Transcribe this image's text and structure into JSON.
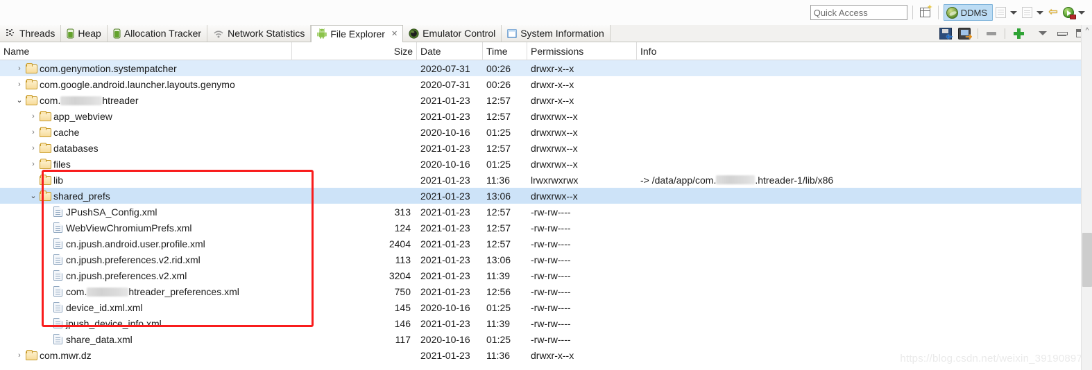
{
  "toolbar": {
    "quick_access_placeholder": "Quick Access",
    "quick_access_value": "",
    "new_perspective_icon": "new-perspective-icon",
    "perspective_ddms_label": "DDMS",
    "step_into_icon": "step-into-icon",
    "step_out_icon": "step-out-icon",
    "back_icon": "back-arrow-icon",
    "run_icon": "run-icon",
    "accent_selected": "#bcdcf4"
  },
  "tabs": [
    {
      "label": "Threads",
      "icon": "threads-icon",
      "active": false,
      "closable": false
    },
    {
      "label": "Heap",
      "icon": "heap-icon",
      "active": false,
      "closable": false
    },
    {
      "label": "Allocation Tracker",
      "icon": "allocation-tracker-icon",
      "active": false,
      "closable": false
    },
    {
      "label": "Network Statistics",
      "icon": "network-statistics-icon",
      "active": false,
      "closable": false
    },
    {
      "label": "File Explorer",
      "icon": "android-icon",
      "active": true,
      "closable": true
    },
    {
      "label": "Emulator Control",
      "icon": "emulator-control-icon",
      "active": false,
      "closable": false
    },
    {
      "label": "System Information",
      "icon": "system-information-icon",
      "active": false,
      "closable": false
    }
  ],
  "tab_close_glyph": "✕",
  "view_tools": [
    {
      "name": "pull-file-from-device-button",
      "icon": "pull-file-icon"
    },
    {
      "name": "push-file-onto-device-button",
      "icon": "push-file-icon"
    },
    {
      "name": "delete-button",
      "icon": "minus-icon"
    },
    {
      "name": "new-folder-button",
      "icon": "plus-icon"
    },
    {
      "name": "view-menu-button",
      "icon": "chevron-down-icon"
    },
    {
      "name": "minimize-button",
      "icon": "minimize-icon"
    },
    {
      "name": "maximize-button",
      "icon": "maximize-icon"
    }
  ],
  "columns": [
    {
      "key": "name",
      "label": "Name",
      "align": "left"
    },
    {
      "key": "size",
      "label": "Size",
      "align": "right"
    },
    {
      "key": "date",
      "label": "Date",
      "align": "left"
    },
    {
      "key": "time",
      "label": "Time",
      "align": "left"
    },
    {
      "key": "permissions",
      "label": "Permissions",
      "align": "left"
    },
    {
      "key": "info",
      "label": "Info",
      "align": "left"
    }
  ],
  "rows": [
    {
      "name": "com.genymotion.systempatcher",
      "size": "",
      "date": "2020-07-31",
      "time": "00:26",
      "permissions": "drwxr-x--x",
      "info": "",
      "depth": 1,
      "kind": "folder",
      "twisty": "collapsed",
      "selected": "light"
    },
    {
      "name": "com.google.android.launcher.layouts.genymo",
      "size": "",
      "date": "2020-07-31",
      "time": "00:26",
      "permissions": "drwxr-x--x",
      "info": "",
      "depth": 1,
      "kind": "folder",
      "twisty": "collapsed",
      "selected": "none"
    },
    {
      "name_prefix": "com.",
      "name_redacted": true,
      "name_suffix": "htreader",
      "name": "com.▮▮▮▮htreader",
      "size": "",
      "date": "2021-01-23",
      "time": "12:57",
      "permissions": "drwxr-x--x",
      "info": "",
      "depth": 1,
      "kind": "folder",
      "twisty": "expanded",
      "selected": "none"
    },
    {
      "name": "app_webview",
      "size": "",
      "date": "2021-01-23",
      "time": "12:57",
      "permissions": "drwxrwx--x",
      "info": "",
      "depth": 2,
      "kind": "folder",
      "twisty": "collapsed",
      "selected": "none"
    },
    {
      "name": "cache",
      "size": "",
      "date": "2020-10-16",
      "time": "01:25",
      "permissions": "drwxrwx--x",
      "info": "",
      "depth": 2,
      "kind": "folder",
      "twisty": "collapsed",
      "selected": "none"
    },
    {
      "name": "databases",
      "size": "",
      "date": "2021-01-23",
      "time": "12:57",
      "permissions": "drwxrwx--x",
      "info": "",
      "depth": 2,
      "kind": "folder",
      "twisty": "collapsed",
      "selected": "none"
    },
    {
      "name": "files",
      "size": "",
      "date": "2020-10-16",
      "time": "01:25",
      "permissions": "drwxrwx--x",
      "info": "",
      "depth": 2,
      "kind": "folder",
      "twisty": "collapsed",
      "selected": "none"
    },
    {
      "name": "lib",
      "size": "",
      "date": "2021-01-23",
      "time": "11:36",
      "permissions": "lrwxrwxrwx",
      "info_prefix": "-> /data/app/com.",
      "info_redacted": true,
      "info_suffix": ".htreader-1/lib/x86",
      "info": "-> /data/app/com.▮▮▮▮.htreader-1/lib/x86",
      "depth": 2,
      "kind": "folder",
      "twisty": "none",
      "selected": "none"
    },
    {
      "name": "shared_prefs",
      "size": "",
      "date": "2021-01-23",
      "time": "13:06",
      "permissions": "drwxrwx--x",
      "info": "",
      "depth": 2,
      "kind": "folder",
      "twisty": "expanded",
      "selected": "strong"
    },
    {
      "name": "JPushSA_Config.xml",
      "size": "313",
      "date": "2021-01-23",
      "time": "12:57",
      "permissions": "-rw-rw----",
      "info": "",
      "depth": 3,
      "kind": "file",
      "twisty": "none",
      "selected": "none"
    },
    {
      "name": "WebViewChromiumPrefs.xml",
      "size": "124",
      "date": "2021-01-23",
      "time": "12:57",
      "permissions": "-rw-rw----",
      "info": "",
      "depth": 3,
      "kind": "file",
      "twisty": "none",
      "selected": "none"
    },
    {
      "name": "cn.jpush.android.user.profile.xml",
      "size": "2404",
      "date": "2021-01-23",
      "time": "12:57",
      "permissions": "-rw-rw----",
      "info": "",
      "depth": 3,
      "kind": "file",
      "twisty": "none",
      "selected": "none"
    },
    {
      "name": "cn.jpush.preferences.v2.rid.xml",
      "size": "113",
      "date": "2021-01-23",
      "time": "13:06",
      "permissions": "-rw-rw----",
      "info": "",
      "depth": 3,
      "kind": "file",
      "twisty": "none",
      "selected": "none"
    },
    {
      "name": "cn.jpush.preferences.v2.xml",
      "size": "3204",
      "date": "2021-01-23",
      "time": "11:39",
      "permissions": "-rw-rw----",
      "info": "",
      "depth": 3,
      "kind": "file",
      "twisty": "none",
      "selected": "none"
    },
    {
      "name_prefix": "com.",
      "name_redacted": true,
      "name_suffix": "htreader_preferences.xml",
      "name": "com.▮▮▮▮htreader_preferences.xml",
      "size": "750",
      "date": "2021-01-23",
      "time": "12:56",
      "permissions": "-rw-rw----",
      "info": "",
      "depth": 3,
      "kind": "file",
      "twisty": "none",
      "selected": "none"
    },
    {
      "name": "device_id.xml.xml",
      "size": "145",
      "date": "2020-10-16",
      "time": "01:25",
      "permissions": "-rw-rw----",
      "info": "",
      "depth": 3,
      "kind": "file",
      "twisty": "none",
      "selected": "none"
    },
    {
      "name": "jpush_device_info.xml",
      "size": "146",
      "date": "2021-01-23",
      "time": "11:39",
      "permissions": "-rw-rw----",
      "info": "",
      "depth": 3,
      "kind": "file",
      "twisty": "none",
      "selected": "none"
    },
    {
      "name": "share_data.xml",
      "size": "117",
      "date": "2020-10-16",
      "time": "01:25",
      "permissions": "-rw-rw----",
      "info": "",
      "depth": 3,
      "kind": "file",
      "twisty": "none",
      "selected": "none"
    },
    {
      "name": "com.mwr.dz",
      "size": "",
      "date": "2021-01-23",
      "time": "11:36",
      "permissions": "drwxr-x--x",
      "info": "",
      "depth": 1,
      "kind": "folder",
      "twisty": "collapsed",
      "selected": "none"
    }
  ],
  "annotation": {
    "type": "rectangle",
    "color": "#f91c1c",
    "target": "shared_prefs folder and its xml children"
  },
  "scrollbar": {
    "vertical_up_glyph": "^",
    "orientation": "vertical"
  },
  "watermark": "https://blog.csdn.net/weixin_39190897"
}
